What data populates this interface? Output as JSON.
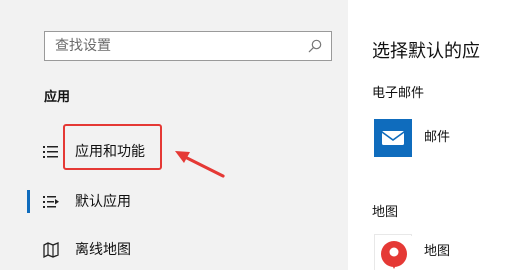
{
  "sidebar": {
    "search": {
      "placeholder": "查找设置",
      "icon": "search-icon"
    },
    "section_title": "应用",
    "items": [
      {
        "label": "应用和功能",
        "icon": "apps-list-icon",
        "selected": false
      },
      {
        "label": "默认应用",
        "icon": "default-apps-icon",
        "selected": true
      },
      {
        "label": "离线地图",
        "icon": "offline-map-icon",
        "selected": false
      }
    ],
    "colors": {
      "background": "#f2f2f2",
      "accent": "#0f6cbd",
      "annotation": "#e53935"
    }
  },
  "content": {
    "title": "选择默认的应",
    "email_section_title": "电子邮件",
    "email_app_label": "邮件",
    "maps_section_title": "地图",
    "maps_app_label": "地图"
  },
  "annotation": {
    "highlight_target": "应用和功能",
    "arrow_direction": "pointing-left"
  }
}
